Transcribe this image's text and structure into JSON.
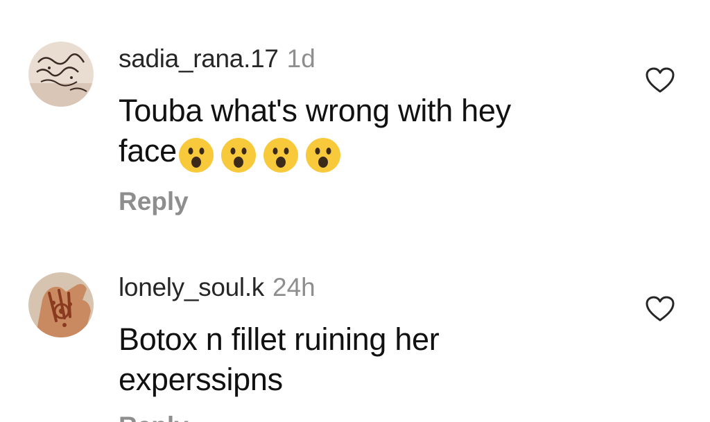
{
  "comments": [
    {
      "username": "sadia_rana.17",
      "time": "1d",
      "text": "Touba what's wrong with hey face",
      "text_line1": "Touba what's wrong with hey",
      "text_line2": "face",
      "emojis": [
        "face-with-open-mouth-icon",
        "face-with-open-mouth-icon",
        "face-with-open-mouth-icon",
        "face-with-open-mouth-icon"
      ],
      "reply_label": "Reply"
    },
    {
      "username": "lonely_soul.k",
      "time": "24h",
      "text_line1": "Botox n fillet ruining her",
      "text_line2": "experssipns",
      "reply_label": "Reply"
    }
  ],
  "colors": {
    "username": "#262626",
    "meta": "#8e8e8e",
    "emoji_face": "#f7c93b"
  }
}
